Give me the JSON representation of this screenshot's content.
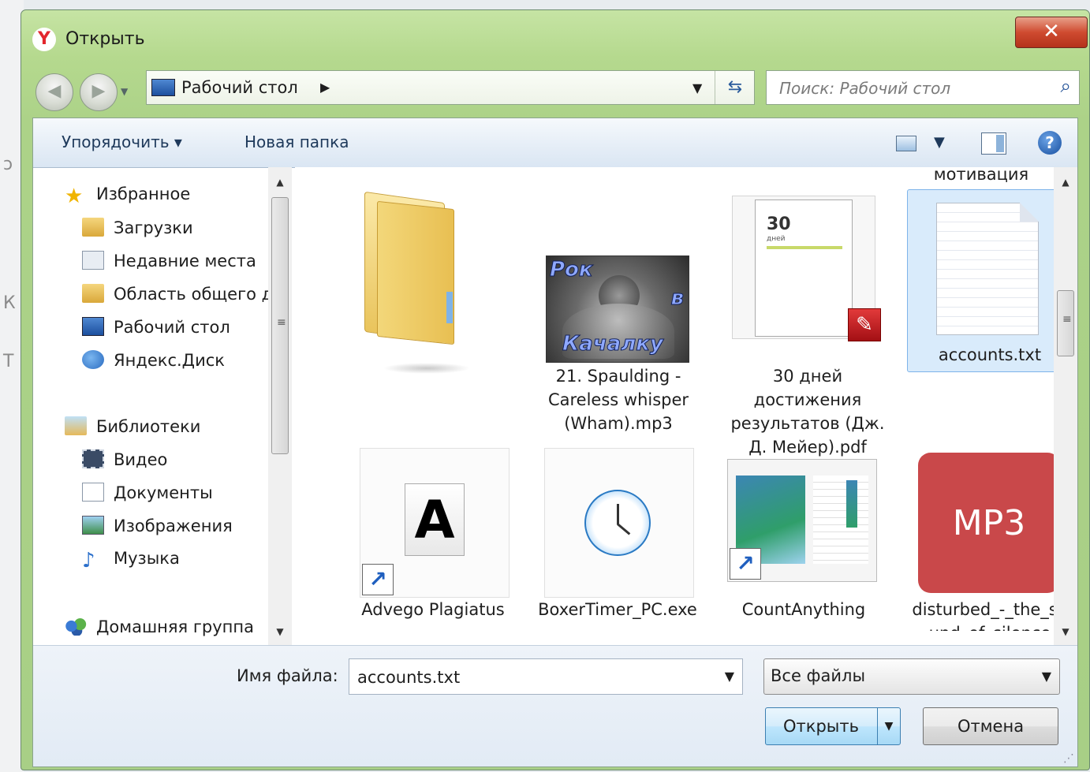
{
  "window": {
    "title": "Открыть",
    "close_label": "✕",
    "logo_letter": "Y"
  },
  "address": {
    "path": "Рабочий стол",
    "search_placeholder": "Поиск: Рабочий стол"
  },
  "toolbar": {
    "organize": "Упорядочить ▾",
    "new_folder": "Новая папка"
  },
  "nav": {
    "favorites": "Избранное",
    "favorites_items": [
      "Загрузки",
      "Недавние места",
      "Область общего д",
      "Рабочий стол",
      "Яндекс.Диск"
    ],
    "libraries": "Библиотеки",
    "libraries_items": [
      "Видео",
      "Документы",
      "Изображения",
      "Музыка"
    ],
    "homegroup": "Домашняя группа"
  },
  "files": {
    "top_partial_label": "мотивация",
    "items": [
      {
        "label": "",
        "icon": "folder-icon"
      },
      {
        "label": "21. Spaulding - Careless whisper (Wham).mp3",
        "icon": "album-art-icon",
        "art_text": [
          "Рок",
          "в",
          "Качалку"
        ]
      },
      {
        "label": "30 дней достижения результатов (Дж. Д. Мейер).pdf",
        "icon": "pdf-icon",
        "cover_text": "30",
        "cover_sub": "дней"
      },
      {
        "label": "accounts.txt",
        "icon": "text-file-icon",
        "selected": true
      },
      {
        "label": "Advego Plagiatus",
        "icon": "font-shortcut-icon"
      },
      {
        "label": "BoxerTimer_PC.exe",
        "icon": "clock-icon"
      },
      {
        "label": "CountAnything",
        "icon": "app-shortcut-icon"
      },
      {
        "label": "disturbed_-_the_sound_of_silence",
        "icon": "mp3-icon",
        "badge": "MP3"
      }
    ]
  },
  "bottom": {
    "filename_label": "Имя файла:",
    "filename_value": "accounts.txt",
    "filetype": "Все файлы",
    "open": "Открыть",
    "cancel": "Отмена"
  },
  "colors": {
    "selection_bg": "#d9ebfb",
    "selection_border": "#7eb4ea",
    "pdf_red": "#c4161c",
    "mp3_red": "#c9484a",
    "folder_yellow": "#f3d77a"
  }
}
